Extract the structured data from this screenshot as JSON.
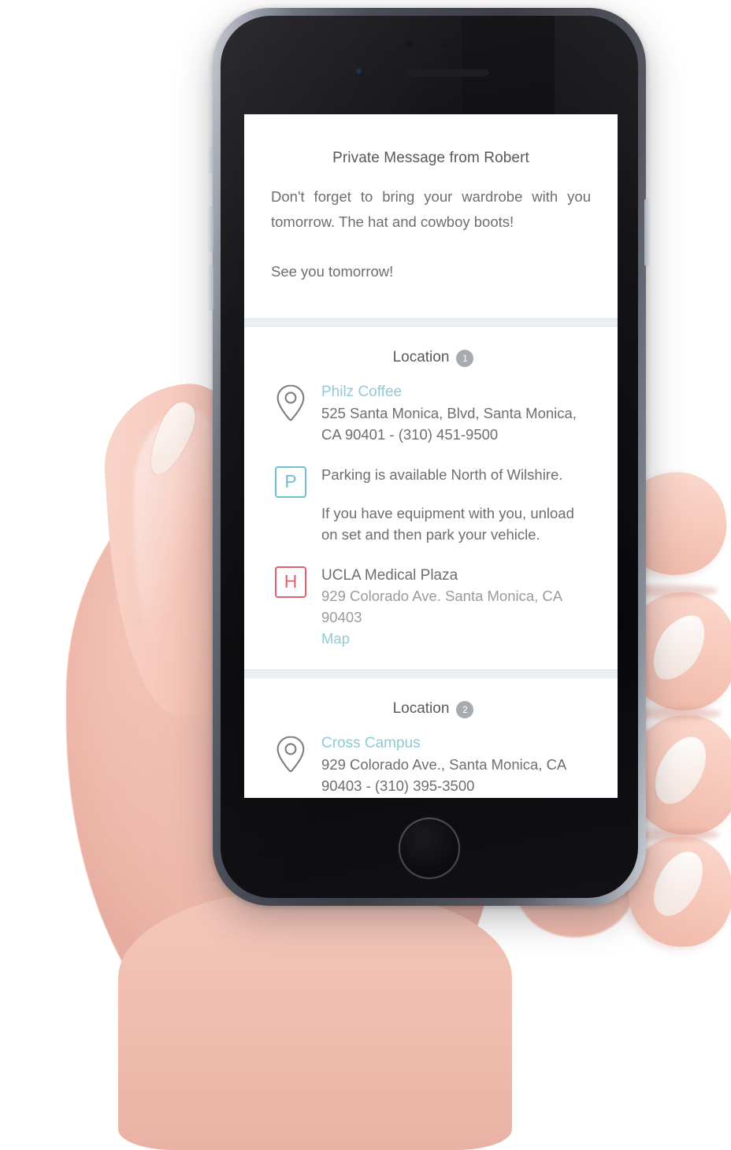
{
  "device": {
    "name": "smartphone",
    "elements": [
      "earpiece-speaker",
      "front-camera",
      "home-button",
      "silent-switch",
      "volume-up-button",
      "volume-down-button",
      "power-button"
    ]
  },
  "colors": {
    "link_teal": "#8ecbd8",
    "icon_teal": "#6ec1d2",
    "icon_red": "#e4606d",
    "badge_grey": "#a7abb0",
    "body_text": "#6d6e71",
    "muted_text": "#9a9b9e",
    "screen_bg": "#eceff3"
  },
  "screen": {
    "message_card": {
      "title": "Private Message from Robert",
      "body": "Don't forget to bring your wardrobe with you tomorrow. The hat and cowboy boots!",
      "signoff": "See you tomorrow!"
    },
    "locations": [
      {
        "heading": "Location",
        "badge": "1",
        "rows": [
          {
            "icon": "map-pin-icon",
            "name": "Philz Coffee",
            "address": "525 Santa Monica, Blvd, Santa Monica, CA 90401  -  (310) 451-9500"
          },
          {
            "icon": "parking-p-icon",
            "line1": "Parking is available North of Wilshire.",
            "line2": "If you have equipment with you, unload on set and then park your vehicle."
          },
          {
            "icon": "hospital-h-icon",
            "name": "UCLA Medical Plaza",
            "address": "929 Colorado Ave. Santa Monica, CA 90403",
            "map_link": "Map"
          }
        ]
      },
      {
        "heading": "Location",
        "badge": "2",
        "rows": [
          {
            "icon": "map-pin-icon",
            "name": "Cross Campus",
            "address": "929 Colorado Ave., Santa Monica, CA 90403  -  (310) 395-3500"
          }
        ]
      }
    ]
  }
}
